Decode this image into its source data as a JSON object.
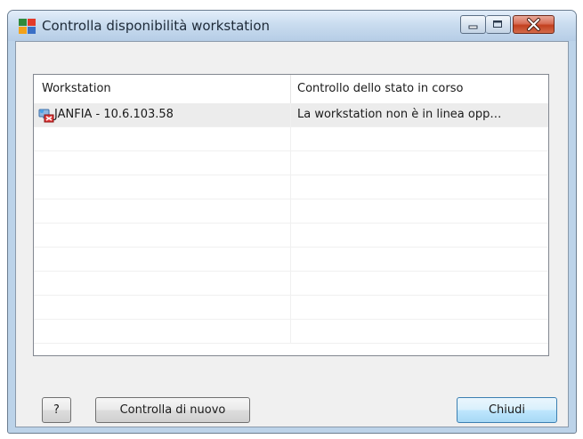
{
  "window": {
    "title": "Controlla disponibilità workstation",
    "app_icon": "avg-logo-icon"
  },
  "list": {
    "columns": [
      "Workstation",
      "Controllo dello stato in corso"
    ],
    "rows": [
      {
        "icon": "workstation-offline-icon",
        "workstation": "JANFIA - 10.6.103.58",
        "status": "La workstation non è in linea opp…"
      }
    ],
    "empty_rows": 9
  },
  "buttons": {
    "help": "?",
    "retry": "Controlla di nuovo",
    "close": "Chiudi"
  },
  "colors": {
    "titlebar": "#c9dcef",
    "close_caption": "#c2401f",
    "default_button_border": "#3c7fb1"
  }
}
